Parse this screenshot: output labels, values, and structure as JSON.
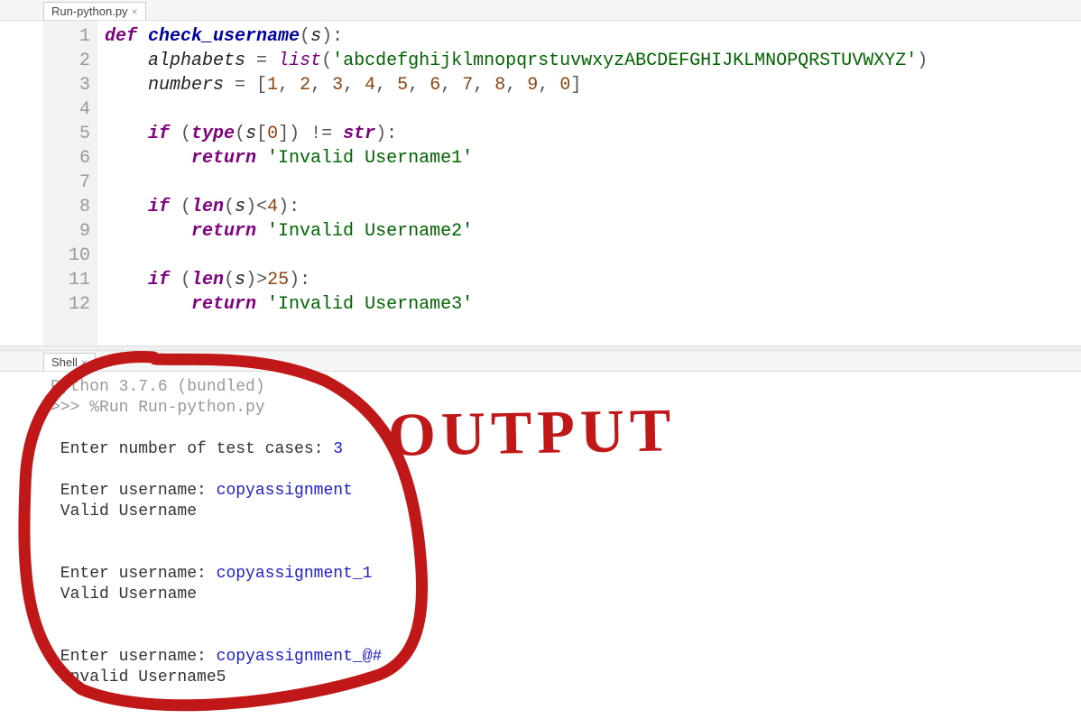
{
  "editor_tab": {
    "label": "Run-python.py"
  },
  "code_lines": [
    {
      "n": 1,
      "tokens": [
        {
          "t": "def ",
          "c": "kw"
        },
        {
          "t": "check_username",
          "c": "def"
        },
        {
          "t": "(",
          "c": "punc"
        },
        {
          "t": "s",
          "c": "var"
        },
        {
          "t": "):",
          "c": "punc"
        }
      ]
    },
    {
      "n": 2,
      "tokens": [
        {
          "t": "    ",
          "c": ""
        },
        {
          "t": "alphabets",
          "c": "var"
        },
        {
          "t": " = ",
          "c": "punc"
        },
        {
          "t": "list",
          "c": "fn"
        },
        {
          "t": "(",
          "c": "punc"
        },
        {
          "t": "'abcdefghijklmnopqrstuvwxyzABCDEFGHIJKLMNOPQRSTUVWXYZ'",
          "c": "str"
        },
        {
          "t": ")",
          "c": "punc"
        }
      ]
    },
    {
      "n": 3,
      "tokens": [
        {
          "t": "    ",
          "c": ""
        },
        {
          "t": "numbers",
          "c": "var"
        },
        {
          "t": " = [",
          "c": "punc"
        },
        {
          "t": "1",
          "c": "num"
        },
        {
          "t": ", ",
          "c": "punc"
        },
        {
          "t": "2",
          "c": "num"
        },
        {
          "t": ", ",
          "c": "punc"
        },
        {
          "t": "3",
          "c": "num"
        },
        {
          "t": ", ",
          "c": "punc"
        },
        {
          "t": "4",
          "c": "num"
        },
        {
          "t": ", ",
          "c": "punc"
        },
        {
          "t": "5",
          "c": "num"
        },
        {
          "t": ", ",
          "c": "punc"
        },
        {
          "t": "6",
          "c": "num"
        },
        {
          "t": ", ",
          "c": "punc"
        },
        {
          "t": "7",
          "c": "num"
        },
        {
          "t": ", ",
          "c": "punc"
        },
        {
          "t": "8",
          "c": "num"
        },
        {
          "t": ", ",
          "c": "punc"
        },
        {
          "t": "9",
          "c": "num"
        },
        {
          "t": ", ",
          "c": "punc"
        },
        {
          "t": "0",
          "c": "num"
        },
        {
          "t": "]",
          "c": "punc"
        }
      ]
    },
    {
      "n": 4,
      "tokens": []
    },
    {
      "n": 5,
      "tokens": [
        {
          "t": "    ",
          "c": ""
        },
        {
          "t": "if",
          "c": "kw"
        },
        {
          "t": " (",
          "c": "punc"
        },
        {
          "t": "type",
          "c": "kw"
        },
        {
          "t": "(",
          "c": "punc"
        },
        {
          "t": "s",
          "c": "var"
        },
        {
          "t": "[",
          "c": "punc"
        },
        {
          "t": "0",
          "c": "num"
        },
        {
          "t": "]) != ",
          "c": "punc"
        },
        {
          "t": "str",
          "c": "kw"
        },
        {
          "t": "):",
          "c": "punc"
        }
      ]
    },
    {
      "n": 6,
      "tokens": [
        {
          "t": "        ",
          "c": ""
        },
        {
          "t": "return",
          "c": "kw"
        },
        {
          "t": " ",
          "c": ""
        },
        {
          "t": "'Invalid Username1'",
          "c": "str"
        }
      ]
    },
    {
      "n": 7,
      "tokens": []
    },
    {
      "n": 8,
      "tokens": [
        {
          "t": "    ",
          "c": ""
        },
        {
          "t": "if",
          "c": "kw"
        },
        {
          "t": " (",
          "c": "punc"
        },
        {
          "t": "len",
          "c": "kw"
        },
        {
          "t": "(",
          "c": "punc"
        },
        {
          "t": "s",
          "c": "var"
        },
        {
          "t": ")<",
          "c": "punc"
        },
        {
          "t": "4",
          "c": "num"
        },
        {
          "t": "):",
          "c": "punc"
        }
      ]
    },
    {
      "n": 9,
      "tokens": [
        {
          "t": "        ",
          "c": ""
        },
        {
          "t": "return",
          "c": "kw"
        },
        {
          "t": " ",
          "c": ""
        },
        {
          "t": "'Invalid Username2'",
          "c": "str"
        }
      ]
    },
    {
      "n": 10,
      "tokens": []
    },
    {
      "n": 11,
      "tokens": [
        {
          "t": "    ",
          "c": ""
        },
        {
          "t": "if",
          "c": "kw"
        },
        {
          "t": " (",
          "c": "punc"
        },
        {
          "t": "len",
          "c": "kw"
        },
        {
          "t": "(",
          "c": "punc"
        },
        {
          "t": "s",
          "c": "var"
        },
        {
          "t": ")>",
          "c": "punc"
        },
        {
          "t": "25",
          "c": "num"
        },
        {
          "t": "):",
          "c": "punc"
        }
      ]
    },
    {
      "n": 12,
      "tokens": [
        {
          "t": "        ",
          "c": ""
        },
        {
          "t": "return",
          "c": "kw"
        },
        {
          "t": " ",
          "c": ""
        },
        {
          "t": "'Invalid Username3'",
          "c": "str"
        }
      ]
    }
  ],
  "shell_tab": {
    "label": "Shell"
  },
  "shell": {
    "banner": "Python 3.7.6 (bundled)",
    "prompt": ">>> ",
    "run_cmd": "%Run Run-python.py",
    "lines": [
      {
        "label": " Enter number of test cases: ",
        "value": "3"
      },
      {
        "blank": true
      },
      {
        "label": " Enter username: ",
        "value": "copyassignment"
      },
      {
        "text": " Valid Username"
      },
      {
        "blank": true
      },
      {
        "blank": true
      },
      {
        "label": " Enter username: ",
        "value": "copyassignment_1"
      },
      {
        "text": " Valid Username"
      },
      {
        "blank": true
      },
      {
        "blank": true
      },
      {
        "label": " Enter username: ",
        "value": "copyassignment_@#"
      },
      {
        "text": " Invalid Username5"
      }
    ]
  },
  "annotation": {
    "text": "OUTPUT"
  }
}
